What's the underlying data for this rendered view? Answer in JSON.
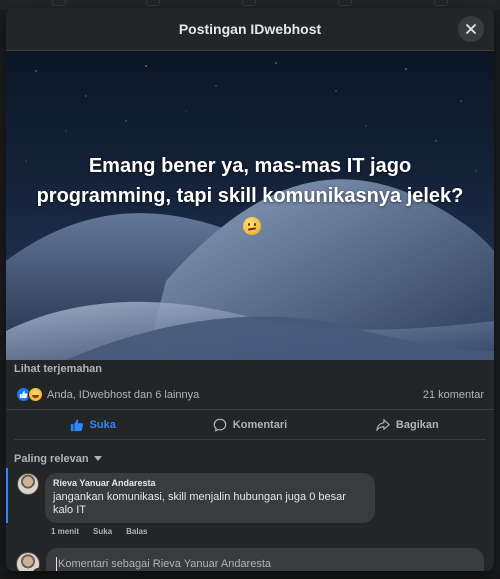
{
  "modal": {
    "title": "Postingan IDwebhost",
    "close_icon": "close-icon"
  },
  "post": {
    "text": "Emang bener ya, mas-mas IT jago programming, tapi skill komunikasnya jelek?",
    "emoji": "thinking-face",
    "translate_link": "Lihat terjemahan"
  },
  "reactions": {
    "icons": [
      "like-reaction-icon",
      "haha-reaction-icon"
    ],
    "summary": "Anda, IDwebhost dan 6 lainnya",
    "comment_count": "21 komentar"
  },
  "actions": {
    "like": "Suka",
    "comment": "Komentari",
    "share": "Bagikan",
    "liked_color": "#2d88ff"
  },
  "sort": {
    "label": "Paling relevan"
  },
  "comments": [
    {
      "author": "Rieva Yanuar Andaresta",
      "text": "jangankan komunikasi, skill menjalin hubungan juga 0 besar kalo IT",
      "time": "1 menit",
      "like": "Suka",
      "reply": "Balas"
    }
  ],
  "composer": {
    "placeholder": "Komentari sebagai Rieva Yanuar Andaresta",
    "tools": [
      "avatar-sticker-icon",
      "camera-icon",
      "emoji-icon",
      "gif-icon",
      "sticker-icon"
    ],
    "send_icon": "send-icon"
  },
  "colors": {
    "background": "#242526",
    "surface": "#3a3b3c",
    "text_primary": "#e4e6eb",
    "text_secondary": "#b0b3b8",
    "accent": "#2d88ff"
  }
}
